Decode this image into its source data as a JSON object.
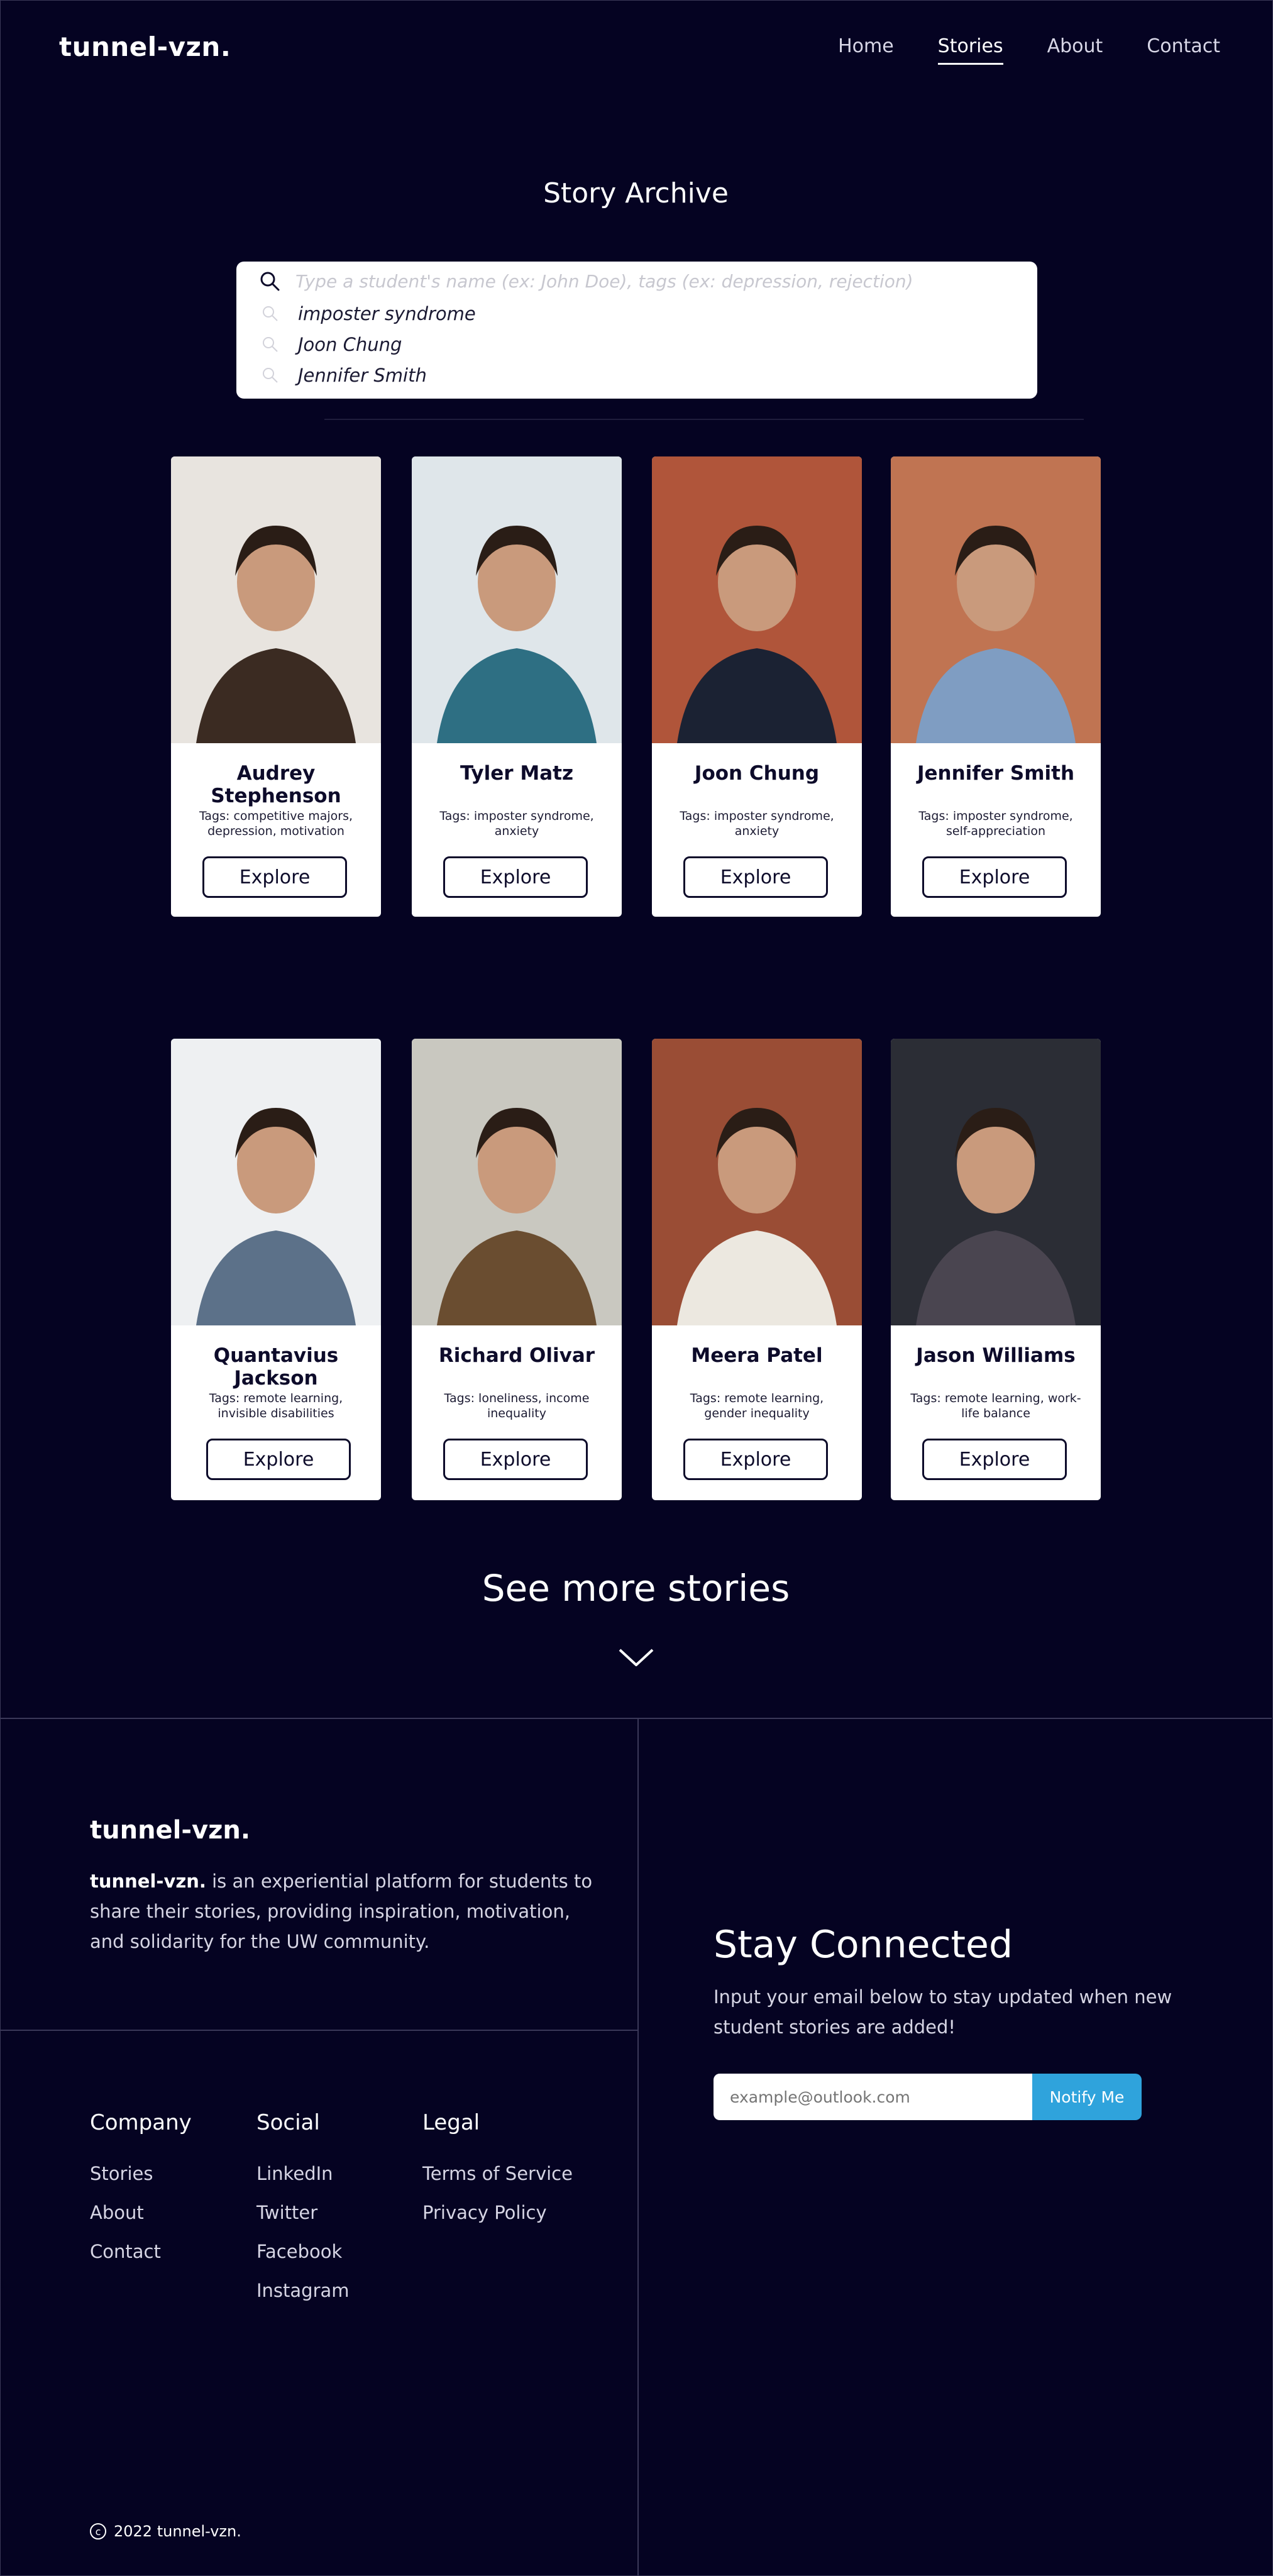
{
  "brand": {
    "logo": "tunnel-vzn."
  },
  "nav": [
    {
      "label": "Home",
      "active": false
    },
    {
      "label": "Stories",
      "active": true
    },
    {
      "label": "About",
      "active": false
    },
    {
      "label": "Contact",
      "active": false
    }
  ],
  "archive": {
    "title": "Story Archive"
  },
  "search": {
    "placeholder": "Type a student's name (ex: John Doe), tags (ex: depression, rejection)",
    "suggestions": [
      "imposter syndrome",
      "Joon Chung",
      "Jennifer Smith"
    ]
  },
  "cards": [
    {
      "name": "Audrey Stephenson",
      "tags": "Tags: competitive majors, depression, motivation",
      "button": "Explore",
      "photo_colors": [
        "#e8e4df",
        "#3b2b22"
      ]
    },
    {
      "name": "Tyler Matz",
      "tags": "Tags: imposter syndrome, anxiety",
      "button": "Explore",
      "photo_colors": [
        "#dfe6ea",
        "#2e6f83"
      ]
    },
    {
      "name": "Joon Chung",
      "tags": "Tags: imposter syndrome, anxiety",
      "button": "Explore",
      "photo_colors": [
        "#b0553a",
        "#1b2233"
      ]
    },
    {
      "name": "Jennifer Smith",
      "tags": "Tags: imposter syndrome, self-appreciation",
      "button": "Explore",
      "photo_colors": [
        "#c07452",
        "#7f9dc2"
      ]
    },
    {
      "name": "Quantavius Jackson",
      "tags": "Tags: remote learning, invisible disabilities",
      "button": "Explore",
      "photo_colors": [
        "#eef0f2",
        "#5c7189"
      ]
    },
    {
      "name": "Richard Olivar",
      "tags": "Tags: loneliness, income inequality",
      "button": "Explore",
      "photo_colors": [
        "#c9c8c0",
        "#6a4d30"
      ]
    },
    {
      "name": "Meera Patel",
      "tags": "Tags: remote learning, gender inequality",
      "button": "Explore",
      "photo_colors": [
        "#9a4d35",
        "#ece8e0"
      ]
    },
    {
      "name": "Jason Williams",
      "tags": "Tags: remote learning, work-life balance",
      "button": "Explore",
      "photo_colors": [
        "#2b2d35",
        "#4a4550"
      ]
    }
  ],
  "see_more": "See more stories",
  "footer": {
    "logo": "tunnel-vzn.",
    "desc_bold": "tunnel-vzn.",
    "desc_rest": " is an experiential platform for students to share their stories, providing inspiration, motivation, and solidarity for the UW community.",
    "columns": [
      {
        "title": "Company",
        "links": [
          "Stories",
          "About",
          "Contact"
        ]
      },
      {
        "title": "Social",
        "links": [
          "LinkedIn",
          "Twitter",
          "Facebook",
          "Instagram"
        ]
      },
      {
        "title": "Legal",
        "links": [
          "Terms of Service",
          "Privacy Policy"
        ]
      }
    ],
    "stay": {
      "title": "Stay Connected",
      "text": "Input your email below to stay updated when new student stories are added!",
      "email_placeholder": "example@outlook.com",
      "button": "Notify Me"
    },
    "copyright": "2022 tunnel-vzn."
  },
  "colors": {
    "background": "#050322",
    "accent": "#2fa3dc",
    "card": "#ffffff"
  }
}
